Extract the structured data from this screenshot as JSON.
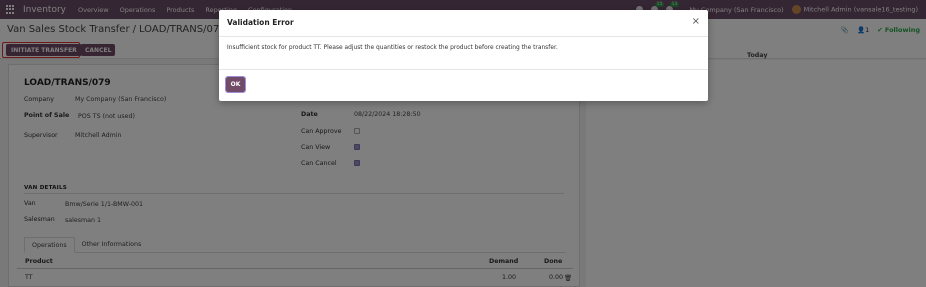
{
  "navbar": {
    "brand": "Inventory",
    "menu": [
      "Overview",
      "Operations",
      "Products",
      "Reporting",
      "Configuration"
    ],
    "badge_messages": "15",
    "badge_activities": "13",
    "company": "My Company (San Francisco)",
    "user": "Mitchell Admin (vansale16_testing)"
  },
  "control_panel": {
    "breadcrumb_parent": "Van Sales Stock Transfer",
    "breadcrumb_separator": "/",
    "breadcrumb_current": "LOAD/TRANS/079",
    "initiate_transfer_label": "INITIATE TRANSFER",
    "cancel_label": "CANCEL",
    "follower_count": "1",
    "following_label": "✔ Following"
  },
  "form": {
    "record_name": "LOAD/TRANS/079",
    "company_label": "Company",
    "company_value": "My Company (San Francisco)",
    "pos_label": "Point of Sale",
    "pos_value": "POS TS (not used)",
    "supervisor_label": "Supervisor",
    "supervisor_value": "Mitchell Admin",
    "date_label": "Date",
    "date_value": "08/22/2024 18:28:50",
    "can_approve_label": "Can Approve",
    "can_view_label": "Can View",
    "can_cancel_label": "Can Cancel",
    "can_approve": false,
    "can_view": true,
    "can_cancel": true,
    "van_details_title": "VAN DETAILS",
    "van_label": "Van",
    "van_value": "Bmw/Serie 1/1-BMW-001",
    "salesman_label": "Salesman",
    "salesman_value": "salesman 1",
    "tabs": [
      "Operations",
      "Other Informations"
    ],
    "table": {
      "headers": [
        "Product",
        "Demand",
        "Done"
      ],
      "rows": [
        {
          "product": "TT",
          "demand": "1.00",
          "done": "0.00"
        }
      ]
    }
  },
  "chatter": {
    "today_label": "Today"
  },
  "dialog": {
    "title": "Validation Error",
    "message": "Insufficient stock for product TT. Please adjust the quantities or restock the product before creating the transfer.",
    "ok_label": "OK",
    "close_glyph": "×"
  },
  "colors": {
    "navbar": "#6b4d66",
    "primary_button": "#714b67",
    "highlight": "#e03131",
    "following": "#28a745"
  }
}
